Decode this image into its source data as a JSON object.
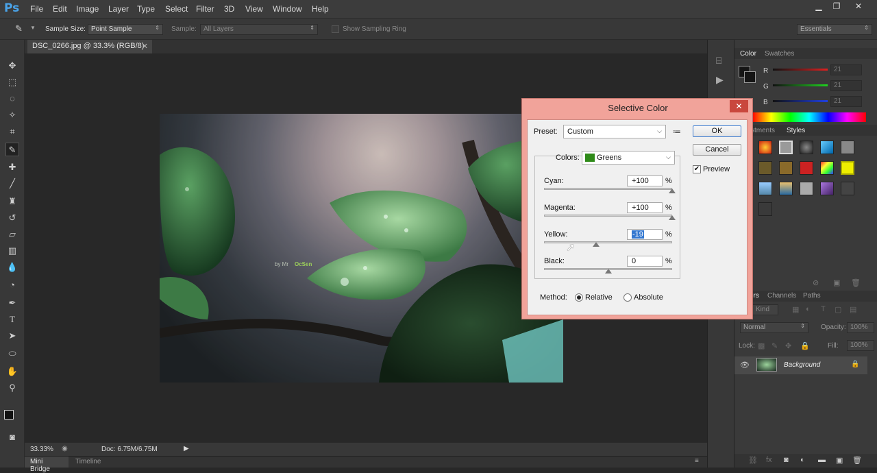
{
  "app": {
    "logo": "Ps",
    "menu": [
      "File",
      "Edit",
      "Image",
      "Layer",
      "Type",
      "Select",
      "Filter",
      "3D",
      "View",
      "Window",
      "Help"
    ],
    "window_controls": [
      "minimize-icon",
      "restore-icon",
      "close-icon"
    ]
  },
  "options_bar": {
    "sample_size_label": "Sample Size:",
    "sample_size_value": "Point Sample",
    "sample_label": "Sample:",
    "sample_value": "All Layers",
    "show_ring_label": "Show Sampling Ring",
    "workspace": "Essentials"
  },
  "document": {
    "tab_title": "DSC_0266.jpg @ 33.3% (RGB/8)",
    "watermark_prefix": "by Mr",
    "watermark_name": "OcSen",
    "zoom": "33.33%",
    "doc_size": "Doc: 6.75M/6.75M"
  },
  "bottom_tabs": [
    "Mini Bridge",
    "Timeline"
  ],
  "color_panel": {
    "tabs": [
      "Color",
      "Swatches"
    ],
    "channels": [
      {
        "label": "R",
        "value": "21"
      },
      {
        "label": "G",
        "value": "21"
      },
      {
        "label": "B",
        "value": "21"
      }
    ]
  },
  "styles_panel": {
    "tabs": [
      "stments",
      "Styles"
    ]
  },
  "layers_panel": {
    "tabs": [
      "ers",
      "Channels",
      "Paths"
    ],
    "kind_filter": "Kind",
    "blend_mode": "Normal",
    "opacity_label": "Opacity:",
    "opacity_value": "100%",
    "lock_label": "Lock:",
    "fill_label": "Fill:",
    "fill_value": "100%",
    "layer_name": "Background"
  },
  "dialog": {
    "title": "Selective Color",
    "preset_label": "Preset:",
    "preset_value": "Custom",
    "colors_label": "Colors:",
    "colors_value": "Greens",
    "colors_swatch": "#2e8a18",
    "ok_label": "OK",
    "cancel_label": "Cancel",
    "preview_label": "Preview",
    "preview_checked": true,
    "sliders": [
      {
        "label": "Cyan:",
        "value": "+100",
        "unit": "%",
        "fraction": 1.0
      },
      {
        "label": "Magenta:",
        "value": "+100",
        "unit": "%",
        "fraction": 1.0
      },
      {
        "label": "Yellow:",
        "value": "-19",
        "unit": "%",
        "fraction": 0.405
      },
      {
        "label": "Black:",
        "value": "0",
        "unit": "%",
        "fraction": 0.5
      }
    ],
    "method_label": "Method:",
    "method_options": [
      "Relative",
      "Absolute"
    ],
    "method_selected": "Relative"
  }
}
